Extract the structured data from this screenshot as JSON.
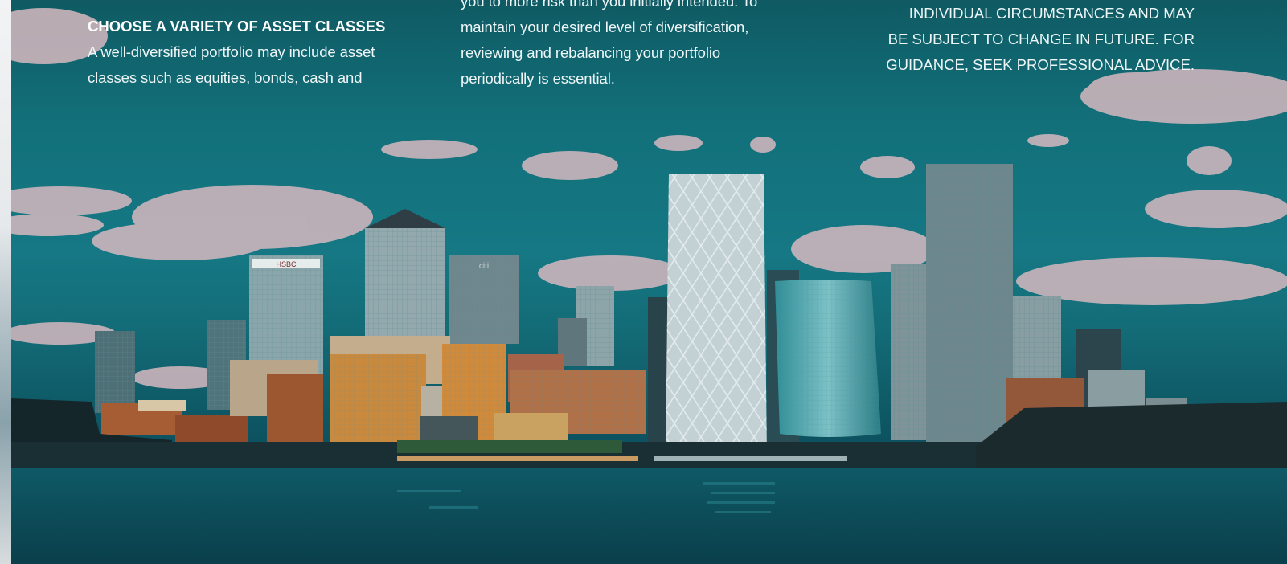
{
  "column_left": {
    "heading": "CHOOSE A VARIETY OF ASSET CLASSES",
    "lines": [
      "A well-diversified portfolio may include asset",
      "classes such as equities, bonds, cash and"
    ]
  },
  "column_middle": {
    "lines": [
      "you to more risk than you initially intended. To",
      "maintain your desired level of diversification,",
      "reviewing and rebalancing your portfolio",
      "periodically is essential."
    ]
  },
  "column_right": {
    "lines": [
      "INDIVIDUAL CIRCUMSTANCES AND MAY",
      "BE SUBJECT TO CHANGE IN FUTURE. FOR",
      "GUIDANCE, SEEK PROFESSIONAL ADVICE."
    ]
  },
  "photo": {
    "subject": "city-skyline-photo",
    "building_signs": [
      "HSBC",
      "citi"
    ]
  },
  "colors": {
    "sky_teal": "#157884",
    "water_teal": "#0b4a57",
    "text": "#eef6f7"
  }
}
